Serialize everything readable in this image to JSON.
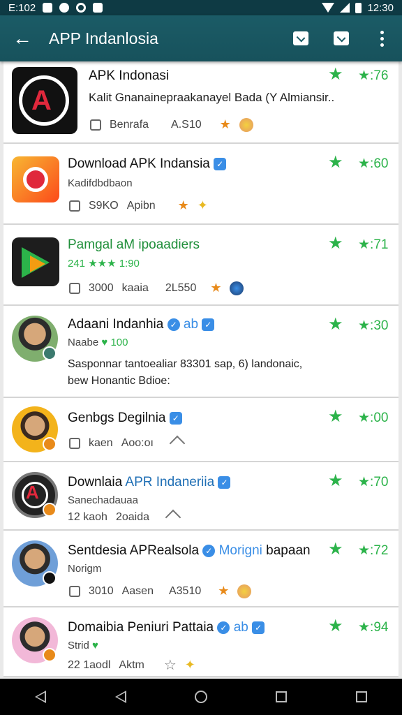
{
  "status_bar": {
    "time_left": "E:102",
    "time_right": "12:30"
  },
  "app_bar": {
    "title": "APP Indanlosia"
  },
  "items": [
    {
      "title": "APK Indonasi",
      "desc": "Kalit Gnanainepraakanayel Bada (Y Almiansir..",
      "meta_a": "Benrafa",
      "meta_b": "A.S10",
      "rating": "76"
    },
    {
      "title": "Download APK Indansia",
      "sub": "Kadifdbdbaon",
      "meta_a": "S9KO",
      "meta_b": "Apibn",
      "rating": "60"
    },
    {
      "title": "Pamgal aM ipoaadiers",
      "sub": "241 ★★★ 1:90",
      "meta_a": "3000",
      "meta_b": "kaaia",
      "meta_c": "2L550",
      "rating": "71"
    },
    {
      "title": "Adaani Indanhia",
      "badge_text": "ab",
      "sub_a": "Naabe",
      "sub_b": "100",
      "desc_line1": "Sasponnar tantoealiar 83301 sap, 6) landonaic,",
      "desc_line2": "bew Honantic Bdioe:",
      "rating": "30"
    },
    {
      "title": "Genbgs Degilnia",
      "meta_a": "kaen",
      "meta_b": "Aoo:oı",
      "rating": "00"
    },
    {
      "title_a": "Downlaia",
      "title_b": "APR Indaneriia",
      "sub": "Sanechadauaa",
      "meta_a": "12 kaoh",
      "meta_b": "2oaida",
      "rating": "70"
    },
    {
      "title": "Sentdesia APRealsola",
      "badge_text": "Morigni",
      "title_suffix": "bapaan",
      "sub": "Norigm",
      "meta_a": "3010",
      "meta_b": "Aasen",
      "meta_c": "A3510",
      "rating": "72"
    },
    {
      "title": "Domaibia Peniuri Pattaia",
      "badge_text": "ab",
      "sub": "Strid",
      "meta_a": "22 1aodl",
      "meta_b": "Aktm",
      "rating": "94"
    }
  ],
  "colors": {
    "app_bar": "#1b5b66",
    "status_bar": "#0e3a44",
    "rating_green": "#2cb34a",
    "badge_blue": "#3a8ee6"
  },
  "icons": [
    "back-arrow-icon",
    "share-box-icon",
    "inbox-icon",
    "more-vert-icon",
    "star-icon",
    "thumb-up-icon"
  ]
}
